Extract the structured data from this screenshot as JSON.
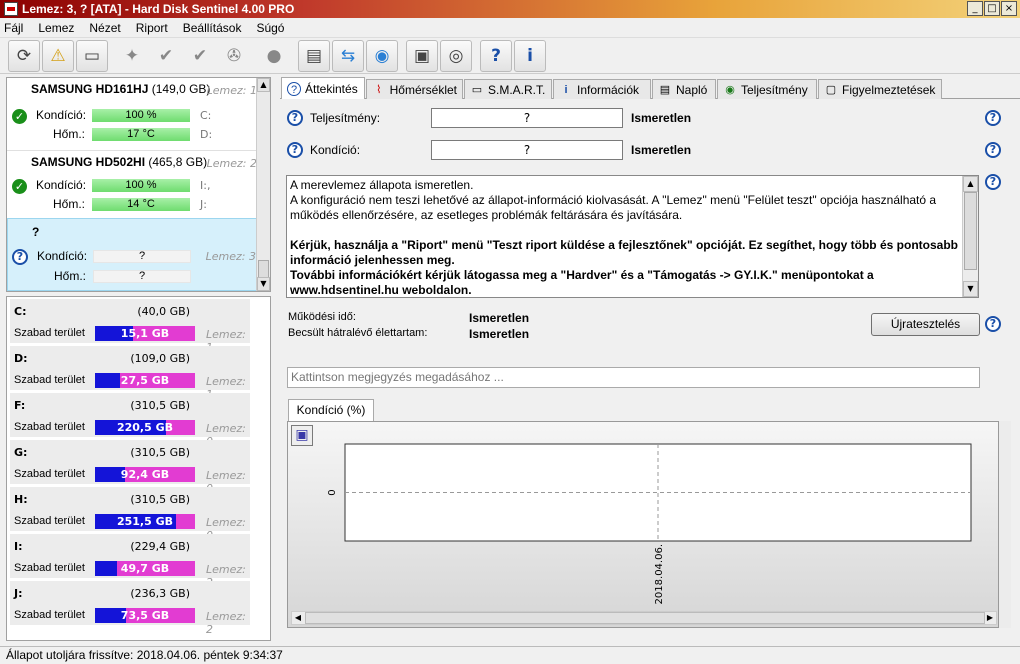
{
  "window": {
    "title": "Lemez: 3, ? [ATA] - Hard Disk Sentinel 4.00 PRO",
    "controls": [
      "_",
      "□",
      "×"
    ]
  },
  "menu": [
    "Fájl",
    "Lemez",
    "Nézet",
    "Riport",
    "Beállítások",
    "Súgó"
  ],
  "toolbar": {
    "icons": [
      "refresh-icon",
      "warning-icon",
      "disk-icon",
      "sep",
      "health-icon",
      "temp-ok-icon",
      "temp-check-icon",
      "gear-disk-icon",
      "sep",
      "blob-icon",
      "sep",
      "report-icon",
      "sync-icon",
      "network-icon",
      "sep",
      "monitor-icon",
      "sound-icon",
      "sep",
      "help-icon",
      "info-icon"
    ]
  },
  "disks": [
    {
      "name": "SAMSUNG HD161HJ",
      "size": "(149,0 GB)",
      "num": "Lemez: 1",
      "kondicio_label": "Kondíció:",
      "kondicio": "100 %",
      "hom_label": "Hőm.:",
      "hom": "17 °C",
      "letter1": "C:",
      "letter2": "D:",
      "status": "ok"
    },
    {
      "name": "SAMSUNG HD502HI",
      "size": "(465,8 GB)",
      "num": "Lemez: 2",
      "kondicio_label": "Kondíció:",
      "kondicio": "100 %",
      "hom_label": "Hőm.:",
      "hom": "14 °C",
      "letter1": "I:,",
      "letter2": "J:",
      "status": "ok"
    },
    {
      "name": "?",
      "size": "",
      "num": "Lemez: 3",
      "kondicio_label": "Kondíció:",
      "kondicio": "?",
      "hom_label": "Hőm.:",
      "hom": "?",
      "letter1": "",
      "letter2": "",
      "status": "unknown"
    }
  ],
  "volumes": [
    {
      "letter": "C:",
      "size": "(40,0 GB)",
      "free_label": "Szabad terület",
      "free": "15,1 GB",
      "free_frac": 0.38,
      "disk": "Lemez: 1"
    },
    {
      "letter": "D:",
      "size": "(109,0 GB)",
      "free_label": "Szabad terület",
      "free": "27,5 GB",
      "free_frac": 0.25,
      "disk": "Lemez: 1"
    },
    {
      "letter": "F:",
      "size": "(310,5 GB)",
      "free_label": "Szabad terület",
      "free": "220,5 GB",
      "free_frac": 0.71,
      "disk": "Lemez: 0"
    },
    {
      "letter": "G:",
      "size": "(310,5 GB)",
      "free_label": "Szabad terület",
      "free": "92,4 GB",
      "free_frac": 0.3,
      "disk": "Lemez: 0"
    },
    {
      "letter": "H:",
      "size": "(310,5 GB)",
      "free_label": "Szabad terület",
      "free": "251,5 GB",
      "free_frac": 0.81,
      "disk": "Lemez: 0"
    },
    {
      "letter": "I:",
      "size": "(229,4 GB)",
      "free_label": "Szabad terület",
      "free": "49,7 GB",
      "free_frac": 0.22,
      "disk": "Lemez: 2"
    },
    {
      "letter": "J:",
      "size": "(236,3 GB)",
      "free_label": "Szabad terület",
      "free": "73,5 GB",
      "free_frac": 0.31,
      "disk": "Lemez: 2"
    }
  ],
  "tabs": [
    "Áttekintés",
    "Hőmérséklet",
    "S.M.A.R.T.",
    "Információk",
    "Napló",
    "Teljesítmény",
    "Figyelmeztetések"
  ],
  "overview": {
    "teljesitmeny_label": "Teljesítmény:",
    "teljesitmeny_value": "?",
    "teljesitmeny_status": "Ismeretlen",
    "kondicio_label": "Kondíció:",
    "kondicio_value": "?",
    "kondicio_status": "Ismeretlen",
    "message_lines": [
      "A merevlemez állapota ismeretlen.",
      "A konfiguráció nem teszi lehetővé az állapot-információ kiolvasását. A \"Lemez\" menü \"Felület teszt\" opciója használható a működés ellenőrzésére, az esetleges problémák feltárására és javítására."
    ],
    "message_bold": [
      "Kérjük, használja a \"Riport\" menü \"Teszt riport küldése a fejlesztőnek\" opcióját. Ez segíthet, hogy több és pontosabb információ jelenhessen meg.",
      "További információkért kérjük látogassa meg a \"Hardver\" és a \"Támogatás -> GY.I.K.\" menüpontokat a www.hdsentinel.hu weboldalon."
    ],
    "uptime_label": "Működési idő:",
    "uptime_value": "Ismeretlen",
    "lifetime_label": "Becsült hátralévő élettartam:",
    "lifetime_value": "Ismeretlen",
    "retest_button": "Újratesztelés",
    "note_placeholder": "Kattintson megjegyzés megadásához ..."
  },
  "chart_tab": "Kondíció  (%)",
  "chart_data": {
    "type": "line",
    "x": [
      "2018.04.06."
    ],
    "series": [
      {
        "values": [
          0
        ]
      }
    ],
    "yticks": [
      "0"
    ]
  },
  "status_text": "Állapot utoljára frissítve: 2018.04.06. péntek 9:34:37"
}
